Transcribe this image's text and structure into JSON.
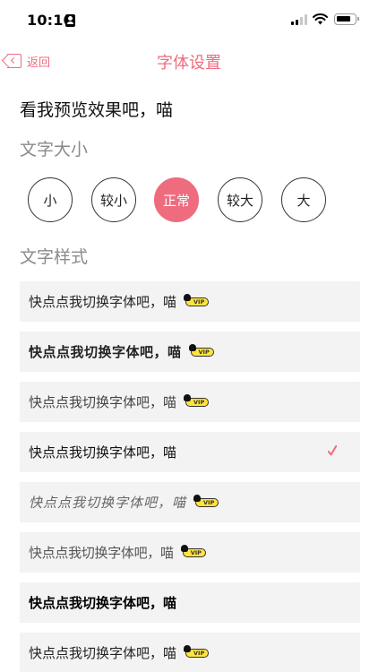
{
  "status_bar": {
    "time": "10:10"
  },
  "nav": {
    "back_label": "返回",
    "title": "字体设置"
  },
  "preview_text": "看我预览效果吧，喵",
  "size_section": {
    "title": "文字大小",
    "options": [
      "小",
      "较小",
      "正常",
      "较大",
      "大"
    ],
    "selected": "正常"
  },
  "style_section": {
    "title": "文字样式",
    "items": [
      {
        "label": "快点点我切换字体吧，喵",
        "vip": "VIP"
      },
      {
        "label": "快点点我切换字体吧，喵",
        "vip": "VIP"
      },
      {
        "label": "快点点我切换字体吧，喵",
        "vip": "VIP"
      },
      {
        "label": "快点点我切换字体吧，喵",
        "selected": true
      },
      {
        "label": "快点点我切换字体吧，喵",
        "vip": "VIP"
      },
      {
        "label": "快点点我切换字体吧，喵",
        "vip": "VIP"
      },
      {
        "label": "快点点我切换字体吧，喵"
      },
      {
        "label": "快点点我切换字体吧，喵",
        "vip": "VIP"
      }
    ]
  },
  "colors": {
    "accent": "#ef6b7e",
    "item_bg": "#f3f3f3",
    "vip_yellow": "#ffe43a"
  }
}
